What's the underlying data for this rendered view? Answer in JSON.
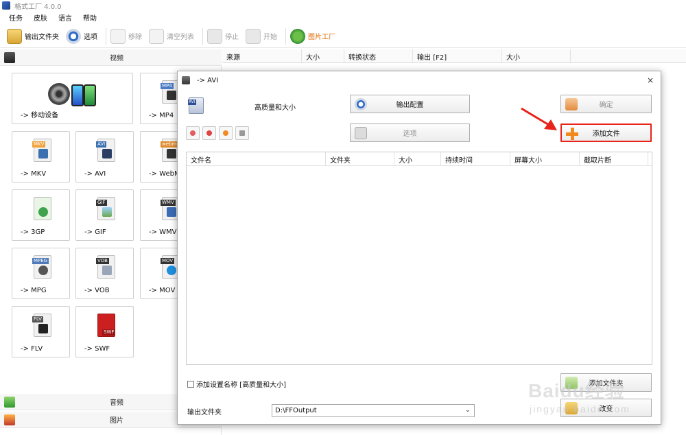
{
  "window": {
    "title": "格式工厂 4.0.0"
  },
  "menu": [
    "任务",
    "皮肤",
    "语言",
    "帮助"
  ],
  "toolbar": {
    "output_folder": "输出文件夹",
    "options": "选项",
    "remove": "移除",
    "clear_list": "清空列表",
    "stop": "停止",
    "start": "开始",
    "picture_factory": "图片工厂"
  },
  "sidebar": {
    "video": "视频",
    "audio": "音频",
    "picture": "图片",
    "tiles": [
      {
        "tag": "",
        "label": "-> 移动设备"
      },
      {
        "tag": "MP4",
        "label": "-> MP4",
        "color": "#4a7bc4"
      },
      {
        "tag": "MKV",
        "label": "-> MKV",
        "color": "#f0a23a"
      },
      {
        "tag": "AVI",
        "label": "-> AVI",
        "color": "#3a6fb0"
      },
      {
        "tag": "webm",
        "label": "-> WebM",
        "color": "#e08b2b"
      },
      {
        "tag": "",
        "label": "-> 3GP",
        "color": "#3fa34d"
      },
      {
        "tag": "GIF",
        "label": "-> GIF",
        "color": "#6aa84f"
      },
      {
        "tag": "WMV",
        "label": "-> WMV",
        "color": "#3b6db5"
      },
      {
        "tag": "MPEG",
        "label": "-> MPG",
        "color": "#4f79b8"
      },
      {
        "tag": "VOB",
        "label": "-> VOB",
        "color": "#777777"
      },
      {
        "tag": "MOV",
        "label": "-> MOV",
        "color": "#1e8fe0"
      },
      {
        "tag": "FLV",
        "label": "-> FLV",
        "color": "#555555"
      },
      {
        "tag": "SWF",
        "label": "-> SWF",
        "color": "#cc1f1f"
      }
    ]
  },
  "filelist": {
    "columns": [
      "来源",
      "大小",
      "转换状态",
      "输出 [F2]",
      "大小"
    ]
  },
  "dialog": {
    "title": "-> AVI",
    "icon_tag": "AVI",
    "profile": "高质量和大小",
    "output_config": "输出配置",
    "options": "选项",
    "ok": "确定",
    "add_file": "添加文件",
    "add_folder": "添加文件夹",
    "change": "改变",
    "table_columns": [
      "文件名",
      "文件夹",
      "大小",
      "持续时间",
      "屏幕大小",
      "截取片断"
    ],
    "add_setting_name": "添加设置名称 [高质量和大小]",
    "output_folder_label": "输出文件夹",
    "output_folder_value": "D:\\FFOutput",
    "close": "×"
  },
  "watermark": {
    "main": "Baidu经验",
    "sub": "jingyan.baidu.com"
  },
  "colors": {
    "accent_orange": "#e46a00",
    "highlight_red": "#e8231a"
  }
}
